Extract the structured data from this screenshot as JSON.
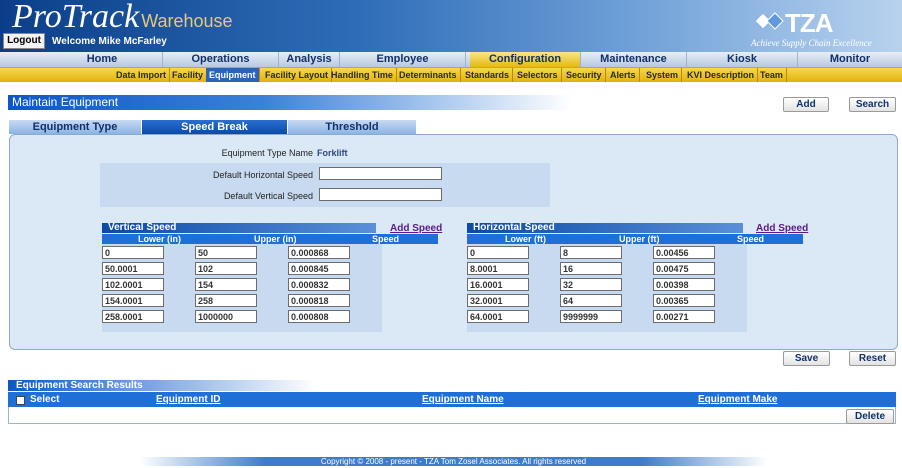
{
  "app": {
    "logo_main": "ProTrack",
    "logo_sub": "Warehouse",
    "logout_label": "Logout",
    "welcome_text": "Welcome Mike McFarley",
    "brand": "TZA",
    "tagline": "Achieve Supply Chain Excellence"
  },
  "nav": {
    "items": [
      "Home",
      "Operations",
      "Analysis",
      "Employee",
      "Configuration",
      "Maintenance",
      "Kiosk",
      "Monitor"
    ],
    "active": "Configuration"
  },
  "subnav": {
    "items": [
      "Data Import",
      "Facility",
      "Equipment",
      "Facility Layout",
      "Handling Time",
      "Determinants",
      "Standards",
      "Selectors",
      "Security",
      "Alerts",
      "System",
      "KVI Description",
      "Team"
    ],
    "active": "Equipment"
  },
  "page": {
    "title": "Maintain Equipment",
    "add_label": "Add",
    "search_label": "Search",
    "save_label": "Save",
    "reset_label": "Reset"
  },
  "tabs": {
    "items": [
      "Equipment Type",
      "Speed Break",
      "Threshold"
    ],
    "active": "Speed Break"
  },
  "form": {
    "equipment_type_label": "Equipment Type Name",
    "equipment_type_value": "Forklift",
    "default_horizontal_label": "Default Horizontal Speed",
    "default_horizontal_value": "",
    "default_vertical_label": "Default Vertical Speed",
    "default_vertical_value": ""
  },
  "vertical_speed": {
    "title": "Vertical Speed",
    "add_label": "Add Speed",
    "columns": [
      "Lower (in)",
      "Upper (in)",
      "Speed"
    ],
    "rows": [
      [
        "0",
        "50",
        "0.000868"
      ],
      [
        "50.0001",
        "102",
        "0.000845"
      ],
      [
        "102.0001",
        "154",
        "0.000832"
      ],
      [
        "154.0001",
        "258",
        "0.000818"
      ],
      [
        "258.0001",
        "1000000",
        "0.000808"
      ]
    ]
  },
  "horizontal_speed": {
    "title": "Horizontal Speed",
    "add_label": "Add Speed",
    "columns": [
      "Lower (ft)",
      "Upper (ft)",
      "Speed"
    ],
    "rows": [
      [
        "0",
        "8",
        "0.00456"
      ],
      [
        "8.0001",
        "16",
        "0.00475"
      ],
      [
        "16.0001",
        "32",
        "0.00398"
      ],
      [
        "32.0001",
        "64",
        "0.00365"
      ],
      [
        "64.0001",
        "9999999",
        "0.00271"
      ]
    ]
  },
  "results": {
    "title": "Equipment Search Results",
    "select_label": "Select",
    "columns": [
      "Equipment ID",
      "Equipment Name",
      "Equipment Make"
    ],
    "delete_label": "Delete"
  },
  "footer": {
    "copyright": "Copyright © 2008 - present - TZA Tom Zosel Associates. All rights reserved"
  },
  "colors": {
    "header_blue": "#0b3e88",
    "nav_active_yellow": "#e6b90f",
    "subnav_yellow": "#f6d84a",
    "accent_blue": "#1e6fd8",
    "panel_bg": "#dbe8f6"
  }
}
